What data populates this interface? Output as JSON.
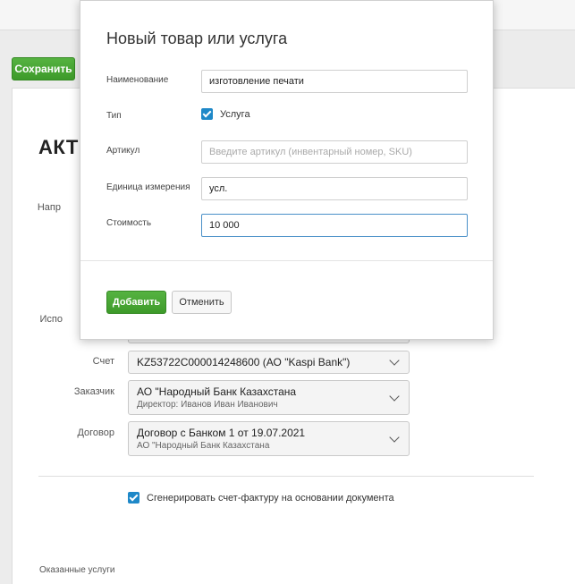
{
  "page": {
    "save_label": "Сохранить",
    "doc_title": "АКТ",
    "labels": {
      "napr": "Напр",
      "ispo": "Испо",
      "account": "Счет",
      "customer": "Заказчик",
      "contract": "Договор"
    },
    "account_select": {
      "value": "KZ53722C000014248600 (АО \"Kaspi Bank\")"
    },
    "customer_select": {
      "value": "АО \"Народный Банк Казахстана",
      "sub": "Директор: Иванов Иван Иванович"
    },
    "contract_select": {
      "value": "Договор с Банком 1 от 19.07.2021",
      "sub": "АО \"Народный Банк Казахстана"
    },
    "generate_invoice_label": "Сгенерировать счет-фактуру на основании документа",
    "generate_invoice_checked": true,
    "services_label": "Оказанные услуги"
  },
  "modal": {
    "title": "Новый товар или услуга",
    "name_label": "Наименование",
    "name_value": "изготовление печати",
    "type_label": "Тип",
    "type_option_label": "Услуга",
    "type_option_checked": true,
    "sku_label": "Артикул",
    "sku_placeholder": "Введите артикул (инвентарный номер, SKU)",
    "unit_label": "Единица измерения",
    "unit_value": "усл.",
    "price_label": "Стоимость",
    "price_value": "10 000",
    "add_label": "Добавить",
    "cancel_label": "Отменить"
  },
  "colors": {
    "accent_green": "#3d9a2a",
    "checkbox_blue": "#1e88c8",
    "focus_blue": "#4a90c8"
  }
}
